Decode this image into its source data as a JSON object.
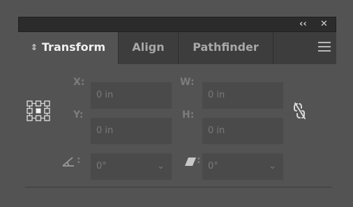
{
  "titlebar": {
    "collapse_icon": "double-left-chevron-icon",
    "close_icon": "close-icon",
    "collapse_glyph": "‹‹",
    "close_glyph": "✕"
  },
  "tabs": [
    {
      "label": "Transform",
      "active": true,
      "prefix_glyph": "⇕"
    },
    {
      "label": "Align",
      "active": false
    },
    {
      "label": "Pathfinder",
      "active": false
    }
  ],
  "menu_icon": "hamburger-menu-icon",
  "fields": {
    "x": {
      "label": "X:",
      "value": "0 in"
    },
    "y": {
      "label": "Y:",
      "value": "0 in"
    },
    "w": {
      "label": "W:",
      "value": "0 in"
    },
    "h": {
      "label": "H:",
      "value": "0 in"
    },
    "rotate": {
      "label": ":",
      "value": "0°",
      "icon": "rotate-angle-icon"
    },
    "shear": {
      "label": ":",
      "value": "0°",
      "icon": "shear-icon"
    }
  },
  "reference_point_icon": "reference-point-icon",
  "constrain_icon": "constrain-proportions-link-icon",
  "chevron_glyph": "⌄",
  "colors": {
    "background": "#535353",
    "titlebar": "#2b2b2b",
    "tabbar": "#3d3d3d",
    "field": "#4a4a4a"
  }
}
